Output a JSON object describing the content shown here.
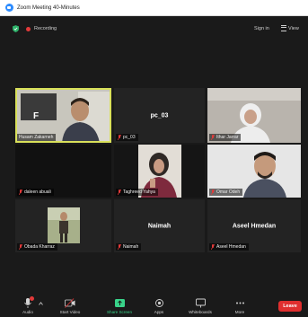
{
  "window": {
    "title": "Zoom Meeting 40-Minutes"
  },
  "topbar": {
    "recording_label": "Recording",
    "signin_label": "Sign in",
    "view_label": "View"
  },
  "tiles": [
    {
      "name": "Husam Zakarneh",
      "center": "",
      "muted": false
    },
    {
      "name": "pc_03",
      "center": "pc_03",
      "muted": true
    },
    {
      "name": "Ithar Jarrar",
      "center": "",
      "muted": true
    },
    {
      "name": "daleen abuali",
      "center": "",
      "muted": true
    },
    {
      "name": "Taghreed Yahya",
      "center": "",
      "muted": true
    },
    {
      "name": "Omar Odeh",
      "center": "",
      "muted": true
    },
    {
      "name": "Obada Kharraz",
      "center": "",
      "muted": true
    },
    {
      "name": "Naimah",
      "center": "Naimah",
      "muted": true
    },
    {
      "name": "Aseel Hmedan",
      "center": "Aseel Hmedan",
      "muted": true
    }
  ],
  "toolbar": {
    "audio": "Audio",
    "start_video": "Start Video",
    "share_screen": "Share Screen",
    "apps": "Apps",
    "whiteboards": "Whiteboards",
    "more": "More",
    "leave": "Leave"
  },
  "colors": {
    "share_green": "#39d38a",
    "leave_red": "#e02f2f",
    "active_speaker": "#d9e05a",
    "mute_red": "#e33a3a"
  }
}
